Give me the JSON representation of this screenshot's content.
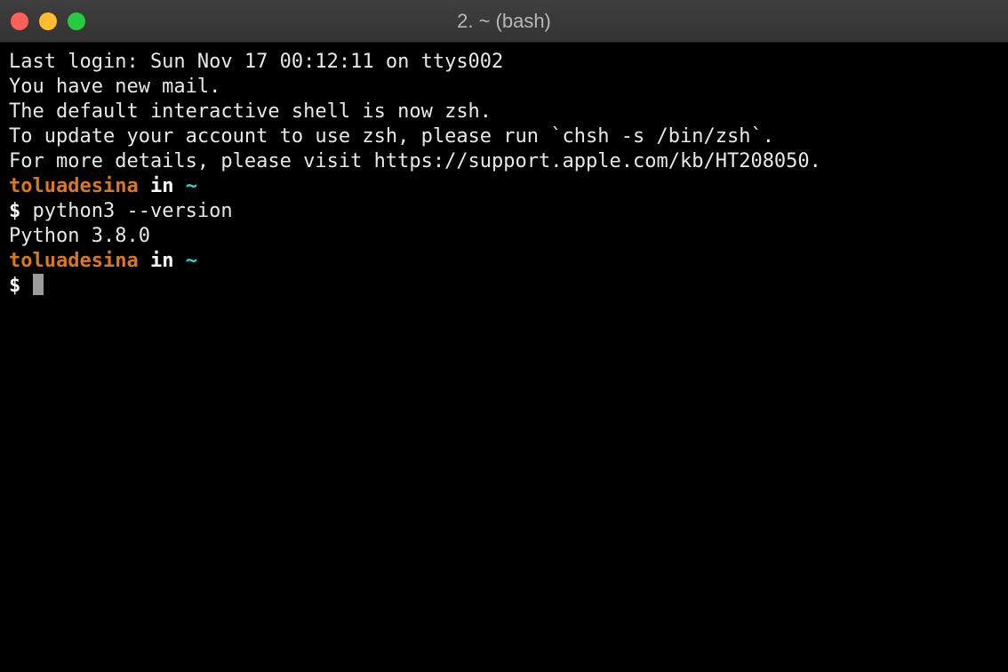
{
  "window": {
    "title": "2. ~ (bash)"
  },
  "terminal": {
    "line1": "Last login: Sun Nov 17 00:12:11 on ttys002",
    "line2": "You have new mail.",
    "line3": "",
    "line4": "The default interactive shell is now zsh.",
    "line5": "To update your account to use zsh, please run `chsh -s /bin/zsh`.",
    "line6": "For more details, please visit https://support.apple.com/kb/HT208050.",
    "line7": "",
    "prompt1": {
      "user": "toluadesina",
      "in": " in ",
      "path": "~"
    },
    "cmd1": {
      "symbol": "$ ",
      "text": "python3 --version"
    },
    "output1": "Python 3.8.0",
    "line_blank2": "",
    "prompt2": {
      "user": "toluadesina",
      "in": " in ",
      "path": "~"
    },
    "cmd2": {
      "symbol": "$ "
    }
  }
}
